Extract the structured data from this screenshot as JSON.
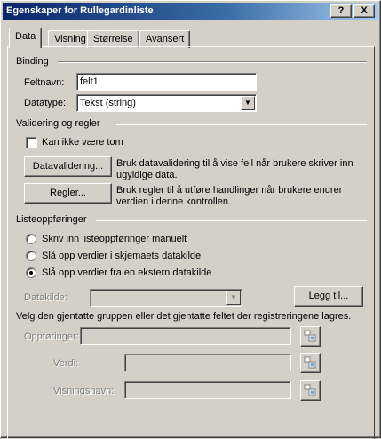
{
  "window": {
    "title": "Egenskaper for Rullegardinliste",
    "help": "?",
    "close": "X"
  },
  "tabs": [
    {
      "label": "Data",
      "active": true
    },
    {
      "label": "Visning"
    },
    {
      "label": "Størrelse"
    },
    {
      "label": "Avansert"
    }
  ],
  "binding": {
    "group": "Binding",
    "field_label": "Feltnavn:",
    "field_value": "felt1",
    "type_label": "Datatype:",
    "type_value": "Tekst (string)"
  },
  "validation": {
    "group": "Validering og regler",
    "not_empty": "Kan ikke være tom",
    "validation_button": "Datavalidering...",
    "validation_desc": "Bruk datavalidering til å vise feil når brukere skriver inn ugyldige data.",
    "rules_button": "Regler...",
    "rules_desc": "Bruk regler til å utføre handlinger når brukere endrer verdien i denne kontrollen."
  },
  "list": {
    "group": "Listeoppføringer",
    "options": [
      "Skriv inn listeoppføringer manuelt",
      "Slå opp verdier i skjemaets datakilde",
      "Slå opp verdier fra en ekstern datakilde"
    ],
    "selected_index": 2,
    "source_label": "Datakilde:",
    "add_button": "Legg til...",
    "instruction": "Velg den gjentatte gruppen eller det gjentatte feltet der registreringene lagres.",
    "entries_label": "Oppføringer:",
    "value_label": "Verdi:",
    "display_label": "Visningsnavn:"
  }
}
